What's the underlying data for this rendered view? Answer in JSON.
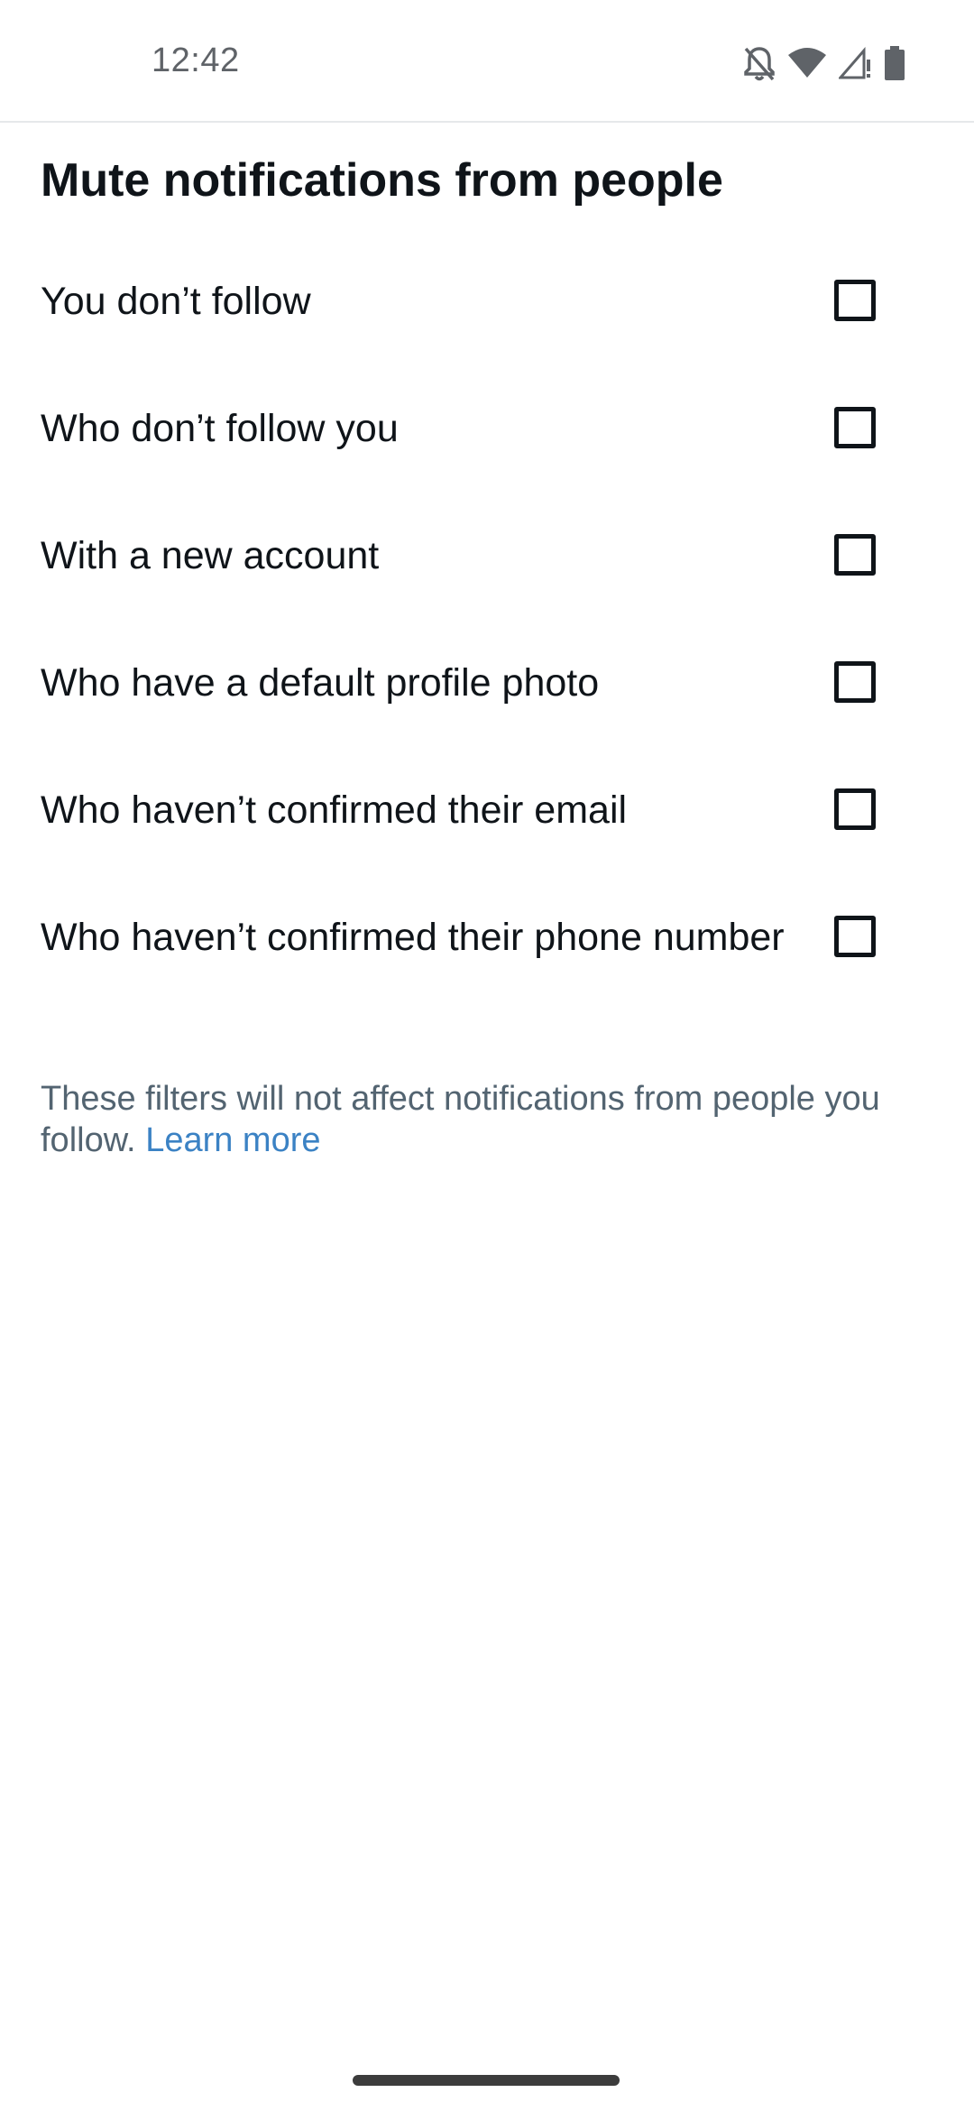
{
  "status_bar": {
    "time": "12:42",
    "icons": [
      "bell-off-icon",
      "wifi-icon",
      "cell-signal-icon",
      "battery-icon"
    ]
  },
  "page": {
    "title": "Mute notifications from people"
  },
  "options": [
    {
      "label": "You don’t follow",
      "checked": false
    },
    {
      "label": "Who don’t follow you",
      "checked": false
    },
    {
      "label": "With a new account",
      "checked": false
    },
    {
      "label": "Who have a default profile photo",
      "checked": false
    },
    {
      "label": "Who haven’t confirmed their email",
      "checked": false
    },
    {
      "label": "Who haven’t confirmed their phone number",
      "checked": false
    }
  ],
  "footer": {
    "note": "These filters will not affect notifications from people you follow.",
    "link_label": "Learn more"
  },
  "colors": {
    "text": "#0f1419",
    "secondary_text": "#536471",
    "link": "#3b82c4",
    "background": "#ffffff"
  }
}
